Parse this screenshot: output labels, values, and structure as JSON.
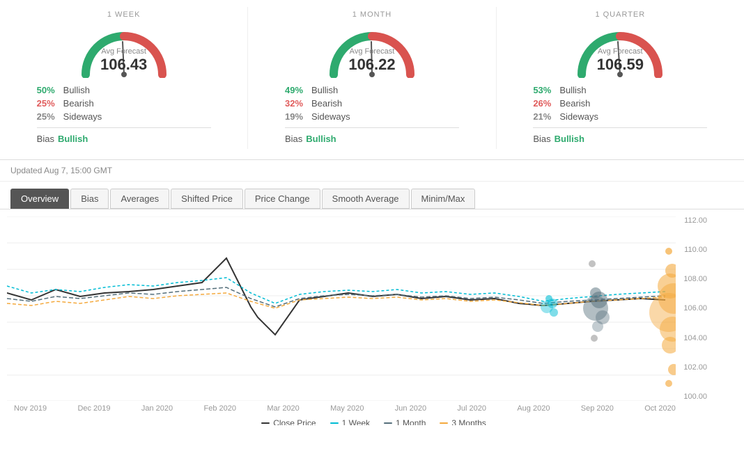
{
  "panels": [
    {
      "period": "1 WEEK",
      "avg_forecast_label": "Avg Forecast",
      "avg_forecast_value": "106.43",
      "bullish_pct": "50%",
      "bearish_pct": "25%",
      "sideways_pct": "25%",
      "bias_label": "Bias",
      "bias_value": "Bullish",
      "gauge_needle_angle": -10,
      "gauge_color_main": "#2eaa6e"
    },
    {
      "period": "1 MONTH",
      "avg_forecast_label": "Avg Forecast",
      "avg_forecast_value": "106.22",
      "bullish_pct": "49%",
      "bearish_pct": "32%",
      "sideways_pct": "19%",
      "bias_label": "Bias",
      "bias_value": "Bullish",
      "gauge_needle_angle": -5,
      "gauge_color_main": "#2eaa6e"
    },
    {
      "period": "1 QUARTER",
      "avg_forecast_label": "Avg Forecast",
      "avg_forecast_value": "106.59",
      "bullish_pct": "53%",
      "bearish_pct": "26%",
      "sideways_pct": "21%",
      "bias_label": "Bias",
      "bias_value": "Bullish",
      "gauge_needle_angle": -8,
      "gauge_color_main": "#2eaa6e"
    }
  ],
  "updated": "Updated Aug 7, 15:00 GMT",
  "tabs": [
    {
      "id": "overview",
      "label": "Overview",
      "active": true
    },
    {
      "id": "bias",
      "label": "Bias",
      "active": false
    },
    {
      "id": "averages",
      "label": "Averages",
      "active": false
    },
    {
      "id": "shifted-price",
      "label": "Shifted Price",
      "active": false
    },
    {
      "id": "price-change",
      "label": "Price Change",
      "active": false
    },
    {
      "id": "smooth-average",
      "label": "Smooth Average",
      "active": false
    },
    {
      "id": "minim-max",
      "label": "Minim/Max",
      "active": false
    }
  ],
  "y_axis": [
    "112.00",
    "110.00",
    "108.00",
    "106.00",
    "104.00",
    "102.00",
    "100.00"
  ],
  "x_axis": [
    "Nov 2019",
    "Dec 2019",
    "Jan 2020",
    "Feb 2020",
    "Mar 2020",
    "May 2020",
    "Jun 2020",
    "Jul 2020",
    "Aug 2020",
    "Sep 2020",
    "Oct 2020"
  ],
  "legend": [
    {
      "id": "close",
      "label": "Close Price",
      "class": "close"
    },
    {
      "id": "week",
      "label": "1 Week",
      "class": "week"
    },
    {
      "id": "month",
      "label": "1 Month",
      "class": "month"
    },
    {
      "id": "quarter",
      "label": "3 Months",
      "class": "quarter"
    }
  ]
}
